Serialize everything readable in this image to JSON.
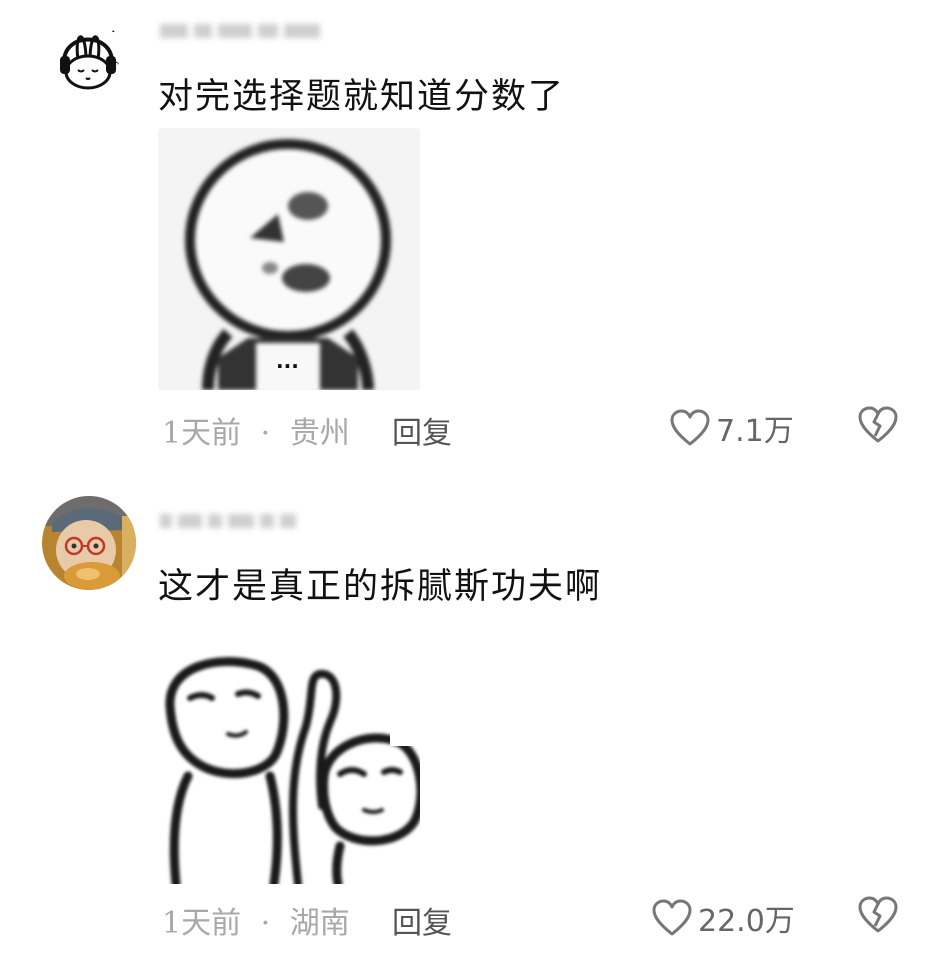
{
  "comments": [
    {
      "text": "对完选择题就知道分数了",
      "time": "1天前",
      "separator": "·",
      "location": "贵州",
      "reply_label": "回复",
      "likes": "7.1万",
      "avatar_icon": "bunny-headphones-avatar",
      "sticker_icon": "meme-face-sticker",
      "sticker_caption": "..."
    },
    {
      "text": "这才是真正的拆腻斯功夫啊",
      "time": "1天前",
      "separator": "·",
      "location": "湖南",
      "reply_label": "回复",
      "likes": "22.0万",
      "avatar_icon": "child-photo-avatar",
      "sticker_icon": "meme-two-faces-sticker"
    }
  ],
  "colors": {
    "meta_text": "#a8a8a8",
    "reply_text": "#555555",
    "icon_stroke": "#777777"
  }
}
